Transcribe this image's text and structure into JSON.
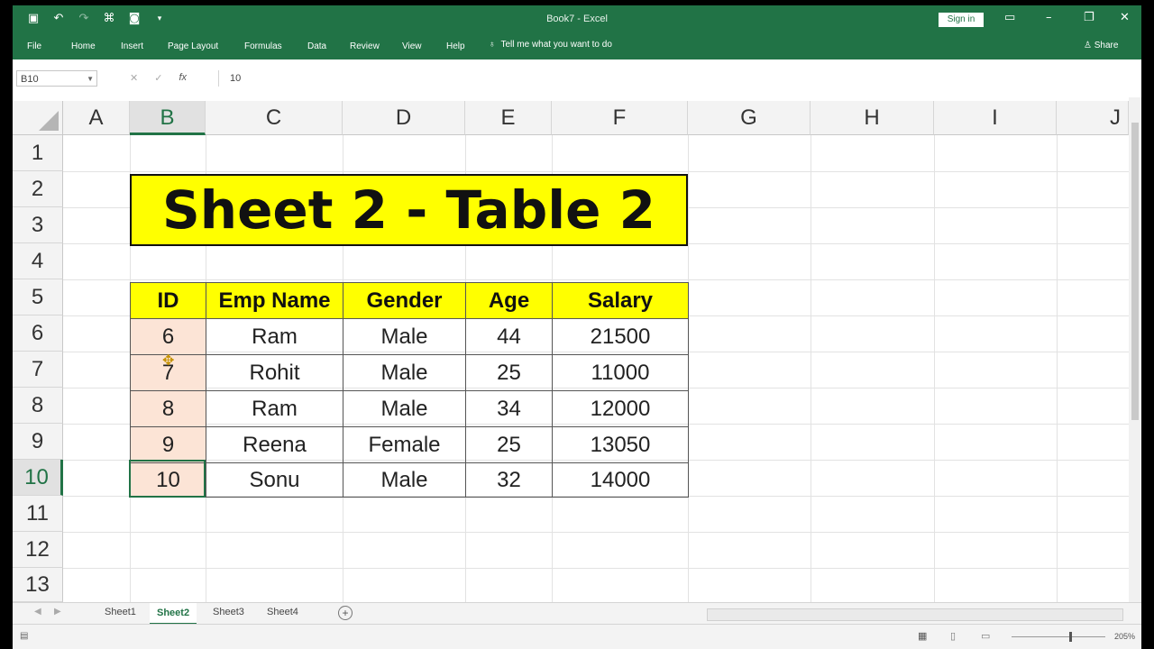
{
  "window": {
    "title": "Book7  -  Excel",
    "signin": "Sign in",
    "share": "Share"
  },
  "ribbon": {
    "tabs": [
      "File",
      "Home",
      "Insert",
      "Page Layout",
      "Formulas",
      "Data",
      "Review",
      "View",
      "Help"
    ],
    "tellme": "Tell me what you want to do"
  },
  "formula_bar": {
    "name_box": "B10",
    "value": "10"
  },
  "columns": [
    "A",
    "B",
    "C",
    "D",
    "E",
    "F",
    "G",
    "H",
    "I",
    "J"
  ],
  "selected_column": "B",
  "rows": [
    "1",
    "2",
    "3",
    "4",
    "5",
    "6",
    "7",
    "8",
    "9",
    "10",
    "11",
    "12",
    "13"
  ],
  "selected_row": "10",
  "banner": "Sheet 2 - Table 2",
  "table": {
    "headers": [
      "ID",
      "Emp Name",
      "Gender",
      "Age",
      "Salary"
    ],
    "rows": [
      [
        "6",
        "Ram",
        "Male",
        "44",
        "21500"
      ],
      [
        "7",
        "Rohit",
        "Male",
        "25",
        "11000"
      ],
      [
        "8",
        "Ram",
        "Male",
        "34",
        "12000"
      ],
      [
        "9",
        "Reena",
        "Female",
        "25",
        "13050"
      ],
      [
        "10",
        "Sonu",
        "Male",
        "32",
        "14000"
      ]
    ]
  },
  "sheets": [
    "Sheet1",
    "Sheet2",
    "Sheet3",
    "Sheet4"
  ],
  "active_sheet": "Sheet2",
  "zoom": "205%",
  "colors": {
    "brand": "#217346",
    "highlight": "#ffff00",
    "id_fill": "#fce4d6"
  }
}
